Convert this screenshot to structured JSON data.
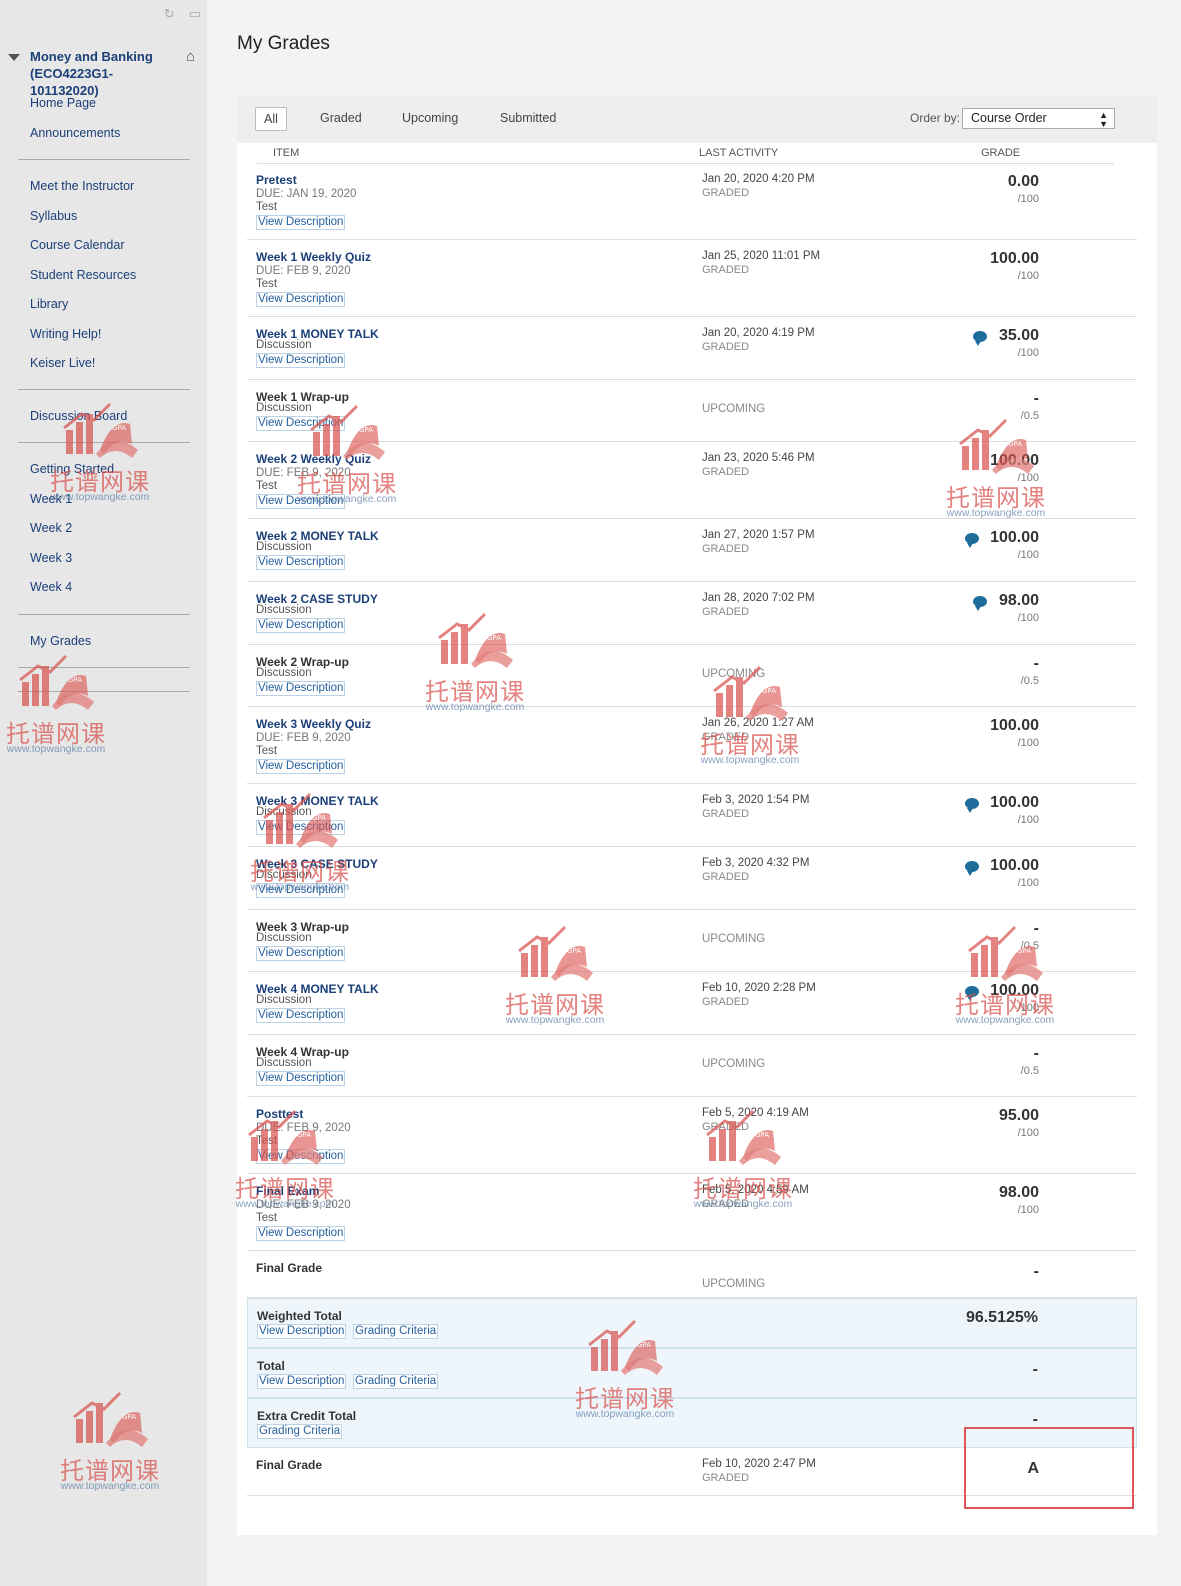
{
  "sidebar": {
    "course_title": "Money and Banking (ECO4223G1-101132020)",
    "group1": [
      "Home Page",
      "Announcements"
    ],
    "group2": [
      "Meet the Instructor",
      "Syllabus",
      "Course Calendar",
      "Student Resources",
      "Library",
      "Writing Help!",
      "Keiser Live!"
    ],
    "group3": [
      "Discussion Board"
    ],
    "group4": [
      "Getting Started",
      "Week 1",
      "Week 2",
      "Week 3",
      "Week 4"
    ],
    "group5": [
      "My Grades"
    ]
  },
  "page": {
    "title": "My Grades"
  },
  "filters": [
    "All",
    "Graded",
    "Upcoming",
    "Submitted"
  ],
  "order": {
    "label": "Order by:",
    "value": "Course Order"
  },
  "columns": {
    "item": "ITEM",
    "activity": "LAST ACTIVITY",
    "grade": "GRADE"
  },
  "rows": [
    {
      "title": "Pretest",
      "due": "DUE: JAN 19, 2020",
      "type": "Test",
      "vd": "View Description",
      "activity": "Jan 20, 2020 4:20 PM",
      "status": "GRADED",
      "grade": "0.00",
      "outof": "/100",
      "comment": false
    },
    {
      "title": "Week 1 Weekly Quiz",
      "due": "DUE: FEB 9, 2020",
      "type": "Test",
      "vd": "View Description",
      "activity": "Jan 25, 2020 11:01 PM",
      "status": "GRADED",
      "grade": "100.00",
      "outof": "/100",
      "comment": false
    },
    {
      "title": "Week 1 MONEY TALK",
      "due": "",
      "type": "Discussion",
      "vd": "View Description",
      "activity": "Jan 20, 2020 4:19 PM",
      "status": "GRADED",
      "grade": "35.00",
      "outof": "/100",
      "comment": true
    },
    {
      "title": "Week 1 Wrap-up",
      "due": "",
      "type": "Discussion",
      "vd": "View Description",
      "activity": "",
      "status": "UPCOMING",
      "grade": "-",
      "outof": "/0.5",
      "comment": false,
      "plain": true
    },
    {
      "title": "Week 2 Weekly Quiz",
      "due": "DUE: FEB 9, 2020",
      "type": "Test",
      "vd": "View Description",
      "activity": "Jan 23, 2020 5:46 PM",
      "status": "GRADED",
      "grade": "100.00",
      "outof": "/100",
      "comment": false
    },
    {
      "title": "Week 2 MONEY TALK",
      "due": "",
      "type": "Discussion",
      "vd": "View Description",
      "activity": "Jan 27, 2020 1:57 PM",
      "status": "GRADED",
      "grade": "100.00",
      "outof": "/100",
      "comment": true
    },
    {
      "title": "Week 2 CASE STUDY",
      "due": "",
      "type": "Discussion",
      "vd": "View Description",
      "activity": "Jan 28, 2020 7:02 PM",
      "status": "GRADED",
      "grade": "98.00",
      "outof": "/100",
      "comment": true
    },
    {
      "title": "Week 2 Wrap-up",
      "due": "",
      "type": "Discussion",
      "vd": "View Description",
      "activity": "",
      "status": "UPCOMING",
      "grade": "-",
      "outof": "/0.5",
      "comment": false,
      "plain": true
    },
    {
      "title": "Week 3 Weekly Quiz",
      "due": "DUE: FEB 9, 2020",
      "type": "Test",
      "vd": "View Description",
      "activity": "Jan 26, 2020 1:27 AM",
      "status": "GRADED",
      "grade": "100.00",
      "outof": "/100",
      "comment": false
    },
    {
      "title": "Week 3 MONEY TALK",
      "due": "",
      "type": "Discussion",
      "vd": "View Description",
      "activity": "Feb 3, 2020 1:54 PM",
      "status": "GRADED",
      "grade": "100.00",
      "outof": "/100",
      "comment": true
    },
    {
      "title": "Week 3 CASE STUDY",
      "due": "",
      "type": "Discussion",
      "vd": "View Description",
      "activity": "Feb 3, 2020 4:32 PM",
      "status": "GRADED",
      "grade": "100.00",
      "outof": "/100",
      "comment": true
    },
    {
      "title": "Week 3 Wrap-up",
      "due": "",
      "type": "Discussion",
      "vd": "View Description",
      "activity": "",
      "status": "UPCOMING",
      "grade": "-",
      "outof": "/0.5",
      "comment": false,
      "plain": true
    },
    {
      "title": "Week 4 MONEY TALK",
      "due": "",
      "type": "Discussion",
      "vd": "View Description",
      "activity": "Feb 10, 2020 2:28 PM",
      "status": "GRADED",
      "grade": "100.00",
      "outof": "/100",
      "comment": true
    },
    {
      "title": "Week 4 Wrap-up",
      "due": "",
      "type": "Discussion",
      "vd": "View Description",
      "activity": "",
      "status": "UPCOMING",
      "grade": "-",
      "outof": "/0.5",
      "comment": false,
      "plain": true
    },
    {
      "title": "Posttest",
      "due": "DUE: FEB 9, 2020",
      "type": "Test",
      "vd": "View Description",
      "activity": "Feb 5, 2020 4:19 AM",
      "status": "GRADED",
      "grade": "95.00",
      "outof": "/100",
      "comment": false
    },
    {
      "title": "Final Exam",
      "due": "DUE: FEB 9, 2020",
      "type": "Test",
      "vd": "View Description",
      "activity": "Feb 5, 2020 4:59 AM",
      "status": "GRADED",
      "grade": "98.00",
      "outof": "/100",
      "comment": false
    }
  ],
  "summary": [
    {
      "title": "Final Grade",
      "status": "UPCOMING",
      "grade": "-"
    },
    {
      "title": "Weighted Total",
      "vd": "View Description",
      "gc": "Grading Criteria",
      "grade": "96.5125%"
    },
    {
      "title": "Total",
      "vd": "View Description",
      "gc": "Grading Criteria",
      "grade": "-"
    },
    {
      "title": "Extra Credit Total",
      "gc": "Grading Criteria",
      "grade": "-"
    },
    {
      "title": "Final Grade",
      "activity": "Feb 10, 2020 2:47 PM",
      "status": "GRADED",
      "grade": "A"
    }
  ],
  "watermark": {
    "cn": "托谱网课",
    "url": "www.topwangke.com",
    "color": "#d9534f"
  }
}
